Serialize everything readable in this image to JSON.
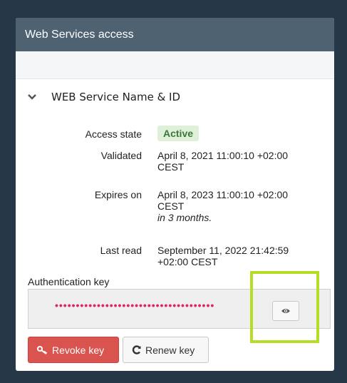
{
  "panel": {
    "title": "Web Services access",
    "section_title": "WEB Service Name & ID"
  },
  "details": {
    "access_state": {
      "label": "Access state",
      "value": "Active"
    },
    "validated": {
      "label": "Validated",
      "line1": "April 8, 2021 11:00:10 +02:00",
      "line2": "CEST"
    },
    "expires": {
      "label": "Expires on",
      "line1": "April 8, 2023 11:00:10 +02:00",
      "line2": "CEST",
      "relative": "in 3 months."
    },
    "last_read": {
      "label": "Last read",
      "line1": "September 11, 2022 21:42:59",
      "line2": "+02:00 CEST"
    }
  },
  "auth": {
    "label": "Authentication key",
    "masked_value": "••••••••••••••••••••••••••••••••••••••"
  },
  "buttons": {
    "revoke": "Revoke key",
    "renew": "Renew key"
  },
  "icons": {
    "section_toggle": "chevron-down-icon",
    "show_key": "eye-icon",
    "revoke": "key-icon",
    "renew": "refresh-icon"
  },
  "colors": {
    "header_bg": "#4f6272",
    "page_bg": "#263747",
    "active_badge_bg": "#dff0d8",
    "active_badge_text": "#3c763d",
    "revoke_button": "#d9534f",
    "masked_dots": "#e0245e",
    "highlight_box": "#b5dc26"
  }
}
